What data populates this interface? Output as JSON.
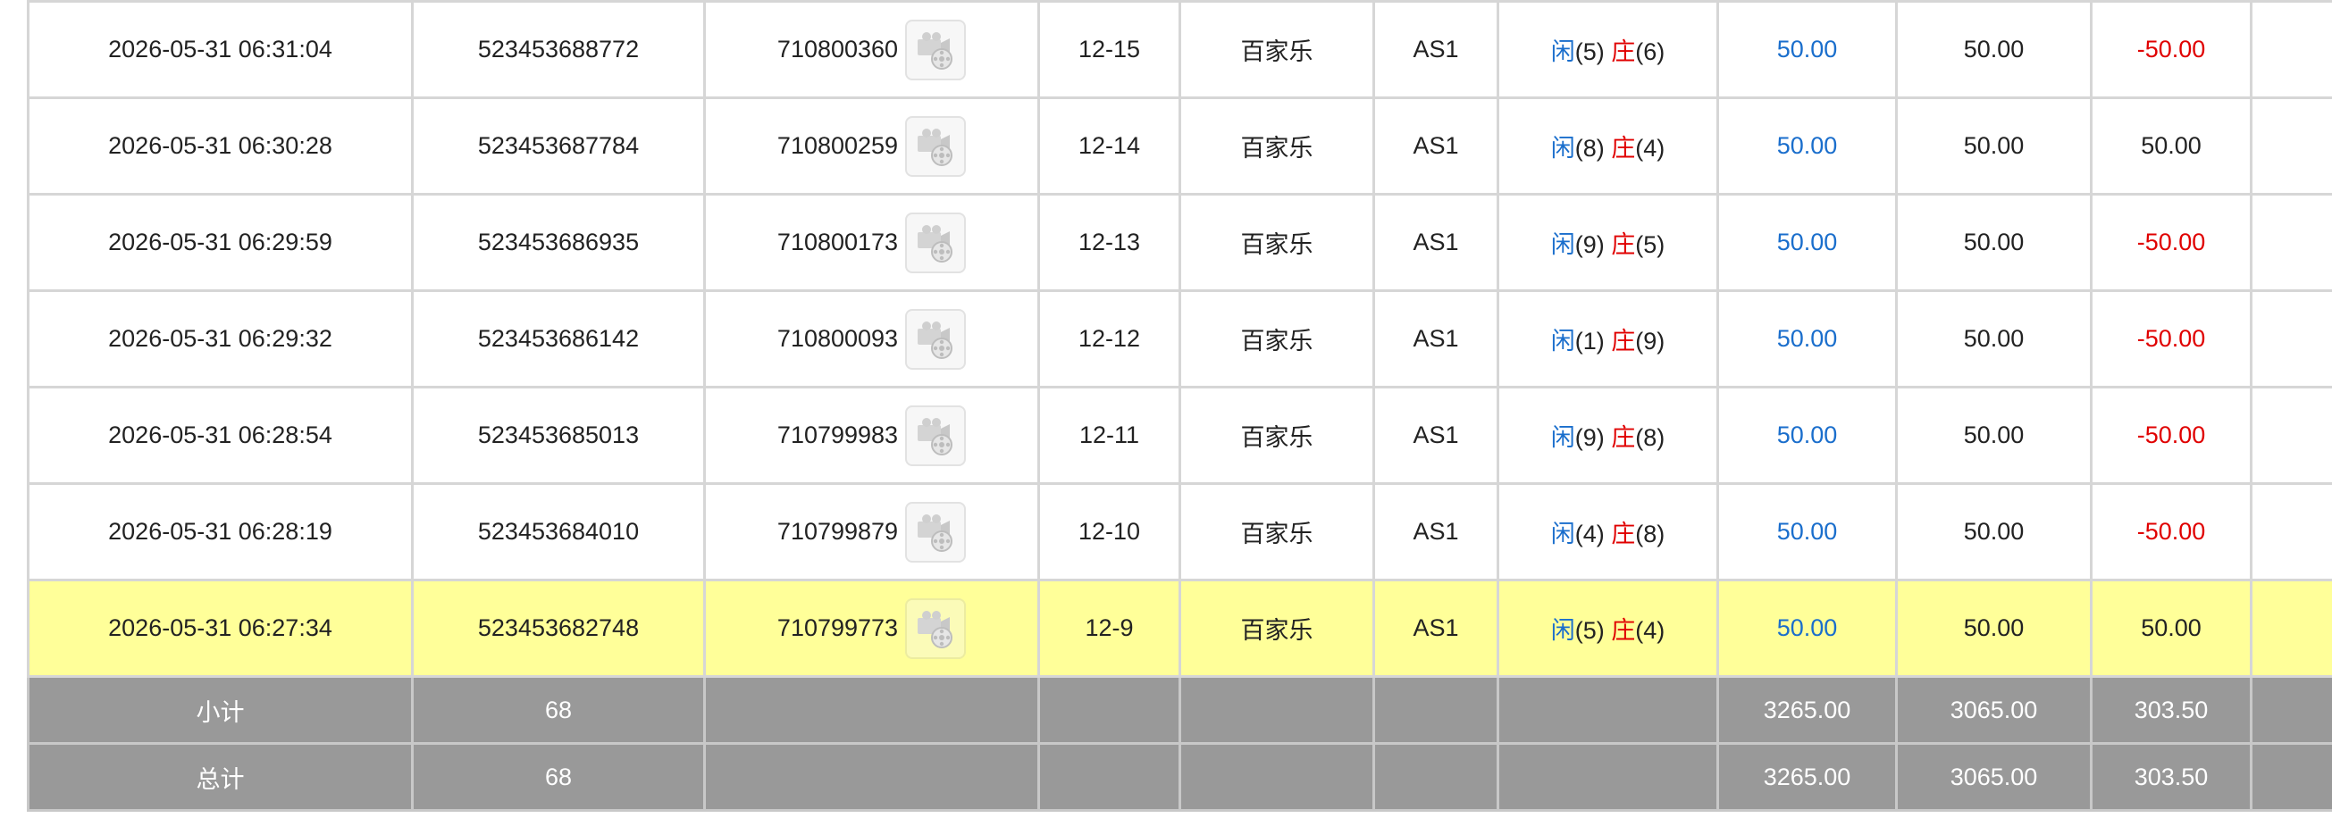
{
  "rows": [
    {
      "time": "2026-05-31 06:31:04",
      "order_id": "523453688772",
      "round_id": "710800360",
      "shoe": "12-15",
      "game": "百家乐",
      "table": "AS1",
      "result": {
        "player_label": "闲",
        "player_value": "(5)",
        "banker_label": "庄",
        "banker_value": "(6)"
      },
      "bet": "50.00",
      "valid_bet": "50.00",
      "win_loss": "-50.00",
      "win_loss_color": "red"
    },
    {
      "time": "2026-05-31 06:30:28",
      "order_id": "523453687784",
      "round_id": "710800259",
      "shoe": "12-14",
      "game": "百家乐",
      "table": "AS1",
      "result": {
        "player_label": "闲",
        "player_value": "(8)",
        "banker_label": "庄",
        "banker_value": "(4)"
      },
      "bet": "50.00",
      "valid_bet": "50.00",
      "win_loss": "50.00",
      "win_loss_color": "black"
    },
    {
      "time": "2026-05-31 06:29:59",
      "order_id": "523453686935",
      "round_id": "710800173",
      "shoe": "12-13",
      "game": "百家乐",
      "table": "AS1",
      "result": {
        "player_label": "闲",
        "player_value": "(9)",
        "banker_label": "庄",
        "banker_value": "(5)"
      },
      "bet": "50.00",
      "valid_bet": "50.00",
      "win_loss": "-50.00",
      "win_loss_color": "red"
    },
    {
      "time": "2026-05-31 06:29:32",
      "order_id": "523453686142",
      "round_id": "710800093",
      "shoe": "12-12",
      "game": "百家乐",
      "table": "AS1",
      "result": {
        "player_label": "闲",
        "player_value": "(1)",
        "banker_label": "庄",
        "banker_value": "(9)"
      },
      "bet": "50.00",
      "valid_bet": "50.00",
      "win_loss": "-50.00",
      "win_loss_color": "red"
    },
    {
      "time": "2026-05-31 06:28:54",
      "order_id": "523453685013",
      "round_id": "710799983",
      "shoe": "12-11",
      "game": "百家乐",
      "table": "AS1",
      "result": {
        "player_label": "闲",
        "player_value": "(9)",
        "banker_label": "庄",
        "banker_value": "(8)"
      },
      "bet": "50.00",
      "valid_bet": "50.00",
      "win_loss": "-50.00",
      "win_loss_color": "red"
    },
    {
      "time": "2026-05-31 06:28:19",
      "order_id": "523453684010",
      "round_id": "710799879",
      "shoe": "12-10",
      "game": "百家乐",
      "table": "AS1",
      "result": {
        "player_label": "闲",
        "player_value": "(4)",
        "banker_label": "庄",
        "banker_value": "(8)"
      },
      "bet": "50.00",
      "valid_bet": "50.00",
      "win_loss": "-50.00",
      "win_loss_color": "red"
    },
    {
      "time": "2026-05-31 06:27:34",
      "order_id": "523453682748",
      "round_id": "710799773",
      "shoe": "12-9",
      "game": "百家乐",
      "table": "AS1",
      "result": {
        "player_label": "闲",
        "player_value": "(5)",
        "banker_label": "庄",
        "banker_value": "(4)"
      },
      "bet": "50.00",
      "valid_bet": "50.00",
      "win_loss": "50.00",
      "win_loss_color": "black",
      "highlighted": true
    }
  ],
  "totals": [
    {
      "label": "小计",
      "count": "68",
      "bet": "3265.00",
      "valid_bet": "3065.00",
      "win_loss": "303.50"
    },
    {
      "label": "总计",
      "count": "68",
      "bet": "3265.00",
      "valid_bet": "3065.00",
      "win_loss": "303.50"
    }
  ],
  "icons": {
    "replay": "video-replay-icon"
  },
  "colors": {
    "player": "#1a6ecc",
    "banker": "#e00000",
    "highlight": "#ffff99",
    "total_bg": "#999999"
  }
}
